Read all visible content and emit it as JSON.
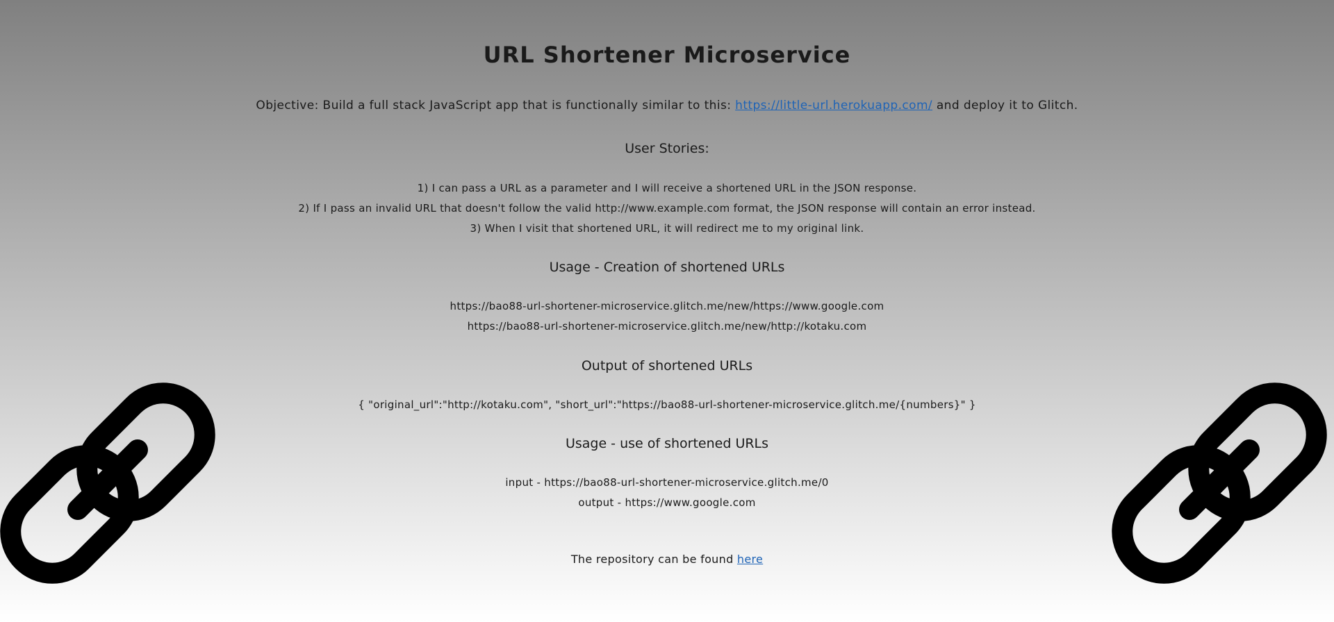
{
  "title": "URL Shortener Microservice",
  "objective": {
    "prefix": "Objective: Build a full stack JavaScript app that is functionally similar to this:",
    "link_text": "https://little-url.herokuapp.com/",
    "suffix": "and deploy it to Glitch."
  },
  "user_stories": {
    "heading": "User Stories:",
    "items": [
      "1) I can pass a URL as a parameter and I will receive a shortened URL in the JSON response.",
      "2) If I pass an invalid URL that doesn't follow the valid http://www.example.com format, the JSON response will contain an error instead.",
      "3) When I visit that shortened URL, it will redirect me to my original link."
    ]
  },
  "creation": {
    "heading": "Usage - Creation of shortened URLs",
    "examples": [
      "https://bao88-url-shortener-microservice.glitch.me/new/https://www.google.com",
      "https://bao88-url-shortener-microservice.glitch.me/new/http://kotaku.com"
    ]
  },
  "output": {
    "heading": "Output of shortened URLs",
    "example": "{ \"original_url\":\"http://kotaku.com\", \"short_url\":\"https://bao88-url-shortener-microservice.glitch.me/{numbers}\" }"
  },
  "use": {
    "heading": "Usage - use of shortened URLs",
    "input": "input - https://bao88-url-shortener-microservice.glitch.me/0",
    "output": "output - https://www.google.com"
  },
  "repository": {
    "prefix": "The repository can be found",
    "link_text": "here"
  },
  "icons": {
    "left": "chain-link-icon",
    "right": "chain-link-icon"
  }
}
